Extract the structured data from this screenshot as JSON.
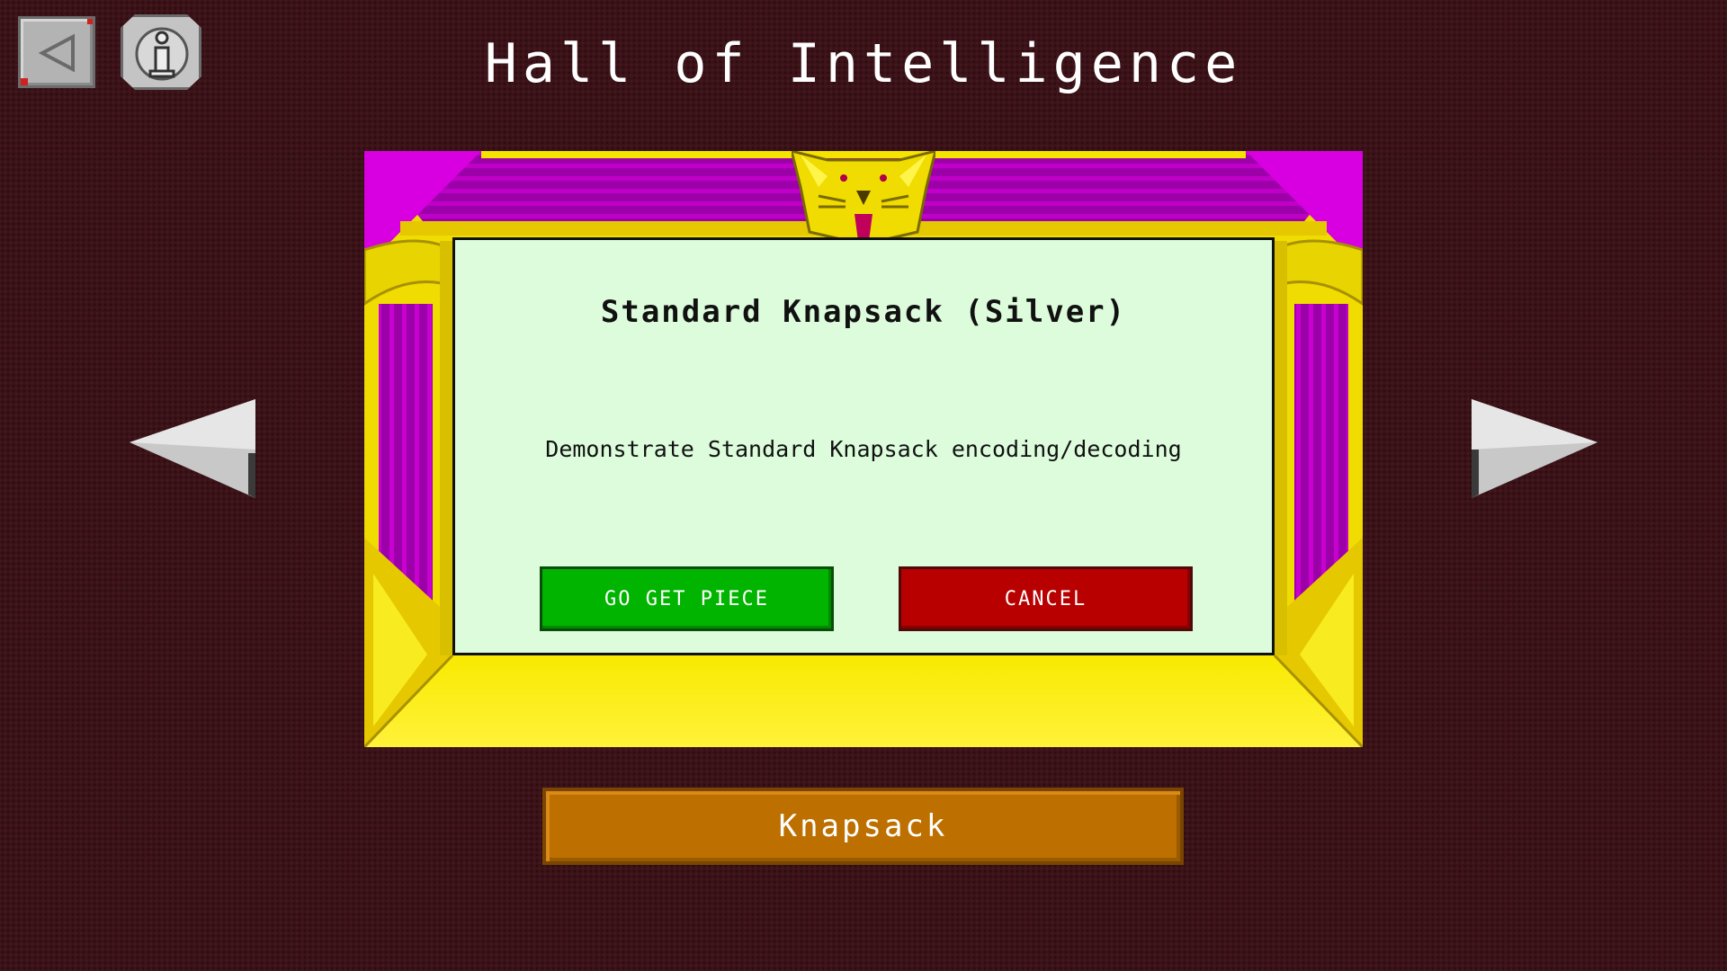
{
  "header": {
    "title": "Hall of Intelligence"
  },
  "toolbar": {
    "back_icon": "back-arrow-icon",
    "info_icon": "info-icon"
  },
  "dialog": {
    "title": "Standard Knapsack (Silver)",
    "description": "Demonstrate Standard Knapsack encoding/decoding",
    "primary_button": "GO GET PIECE",
    "secondary_button": "CANCEL"
  },
  "category": {
    "label": "Knapsack"
  },
  "colors": {
    "background": "#3a1218",
    "frame_gold": "#f5e400",
    "frame_purple": "#b000b8",
    "dialog_bg": "#dcfcdc",
    "go_button": "#00b400",
    "cancel_button": "#b80000",
    "category_bar": "#bd7000"
  }
}
